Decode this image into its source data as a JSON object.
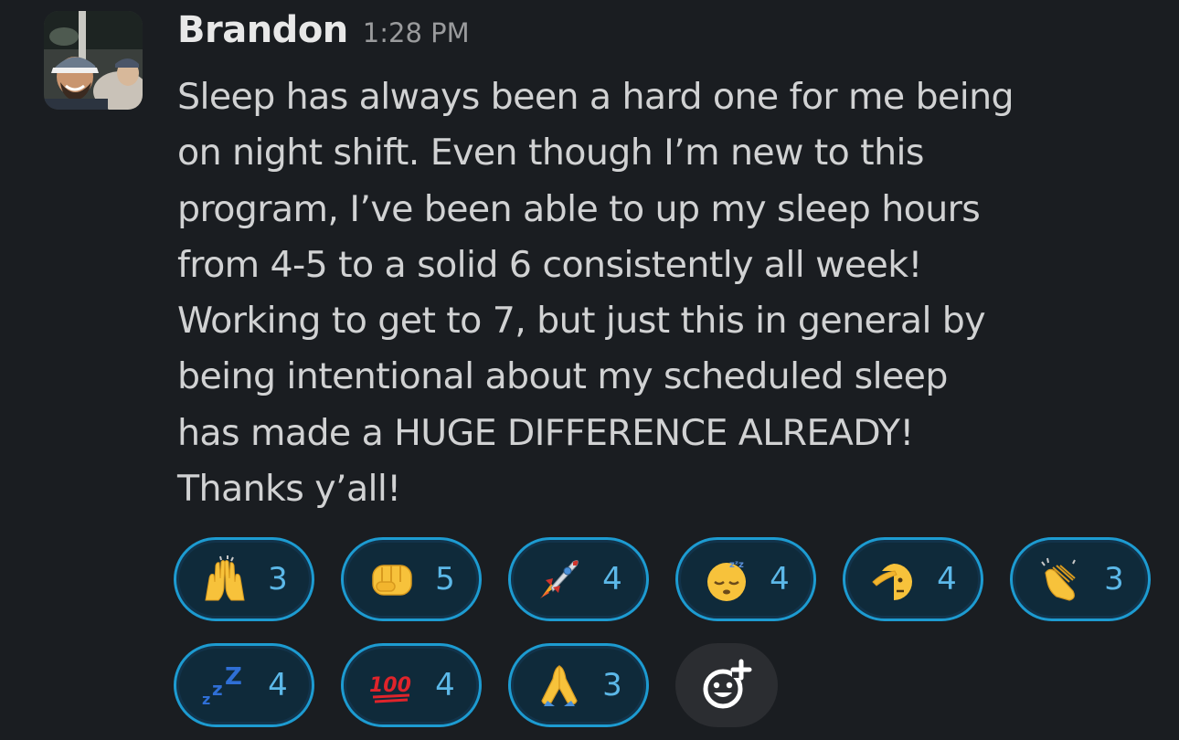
{
  "message": {
    "author": "Brandon",
    "timestamp": "1:28 PM",
    "text": "Sleep has always been a hard one for me being\non night shift. Even though I’m new to this\nprogram, I’ve been able to up my sleep hours\nfrom 4-5 to a solid 6 consistently all week!\nWorking to get to 7, but just this in general by\nbeing intentional about my scheduled sleep\nhas made a HUGE DIFFERENCE ALREADY!\nThanks y’all!"
  },
  "reactions": [
    {
      "emoji": "raised-hands",
      "count": "3"
    },
    {
      "emoji": "fist-bump",
      "count": "5"
    },
    {
      "emoji": "rocket",
      "count": "4"
    },
    {
      "emoji": "sleepy-face",
      "count": "4"
    },
    {
      "emoji": "saluting-face",
      "count": "4"
    },
    {
      "emoji": "clapping-hands",
      "count": "3"
    },
    {
      "emoji": "zzz",
      "count": "4"
    },
    {
      "emoji": "hundred-points",
      "count": "4"
    },
    {
      "emoji": "folded-hands",
      "count": "3"
    }
  ],
  "add_reaction": {
    "icon": "add-reaction-icon"
  },
  "colors": {
    "background": "#1a1d21",
    "reaction_border": "#1d9bd1",
    "reaction_fill": "#0f2a3a",
    "reaction_count": "#5cb8e8",
    "add_reaction_fill": "#2b2d31"
  }
}
